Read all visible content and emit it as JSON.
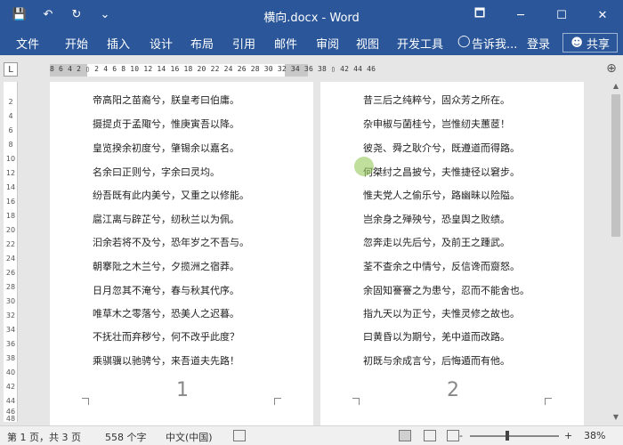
{
  "window": {
    "title": "横向.docx - Word",
    "controls": [
      "🗖",
      "─",
      "☐",
      "✕"
    ]
  },
  "quick_access": {
    "save_icon": "💾",
    "undo_icon": "↶",
    "redo_icon": "↻",
    "customize_icon": "⌄"
  },
  "ribbon": {
    "tabs": [
      "文件",
      "开始",
      "插入",
      "设计",
      "布局",
      "引用",
      "邮件",
      "审阅",
      "视图",
      "开发工具"
    ],
    "tell_me": "告诉我...",
    "login": "登录",
    "share": "共享"
  },
  "ruler": {
    "horizontal": "8 6 4 2 ▯ 2 4 6 8 10 12 14 16 18 20 22 24 26 28 30 32 34 36 38 ▯ 42 44 46",
    "vertical": [
      "2",
      "4",
      "6",
      "8",
      "10",
      "12",
      "14",
      "16",
      "18",
      "20",
      "22",
      "24",
      "26",
      "28",
      "30",
      "32",
      "34",
      "36",
      "38",
      "40",
      "42",
      "44",
      "46",
      "48"
    ],
    "corner_glyph": "L"
  },
  "pages": [
    {
      "number": "1",
      "lines": [
        "帝高阳之苗裔兮，朕皇考曰伯庸。",
        "摄提贞于孟陬兮，惟庚寅吾以降。",
        "皇览揆余初度兮，肇锡余以嘉名。",
        "名余曰正则兮，字余曰灵均。",
        "纷吾既有此内美兮，又重之以修能。",
        "扈江离与辟芷兮，纫秋兰以为佩。",
        "汩余若将不及兮，恐年岁之不吾与。",
        "朝搴阰之木兰兮，夕揽洲之宿莽。",
        "日月忽其不淹兮，春与秋其代序。",
        "唯草木之零落兮，恐美人之迟暮。",
        "不抚壮而弃秽兮，何不改乎此度？",
        "乘骐骥以驰骋兮，来吾道夫先路！"
      ]
    },
    {
      "number": "2",
      "lines": [
        "昔三后之纯粹兮，固众芳之所在。",
        "杂申椒与菌桂兮，岂惟纫夫蕙茝！",
        "彼尧、舜之耿介兮，既遵道而得路。",
        "何桀纣之昌披兮，夫惟捷径以窘步。",
        "惟夫党人之偷乐兮，路幽昧以险隘。",
        "岂余身之殚殃兮，恐皇舆之败绩。",
        "忽奔走以先后兮，及前王之踵武。",
        "荃不查余之中情兮，反信谗而齌怒。",
        "余固知謇謇之为患兮，忍而不能舍也。",
        "指九天以为正兮，夫惟灵修之故也。",
        "曰黄昏以为期兮，羌中道而改路。",
        "初既与余成言兮，后悔遁而有他。"
      ]
    }
  ],
  "status": {
    "page": "第 1 页，共 3 页",
    "words": "558 个字",
    "language": "中文(中国)",
    "zoom_minus": "-",
    "zoom_plus": "+",
    "zoom": "38%"
  }
}
